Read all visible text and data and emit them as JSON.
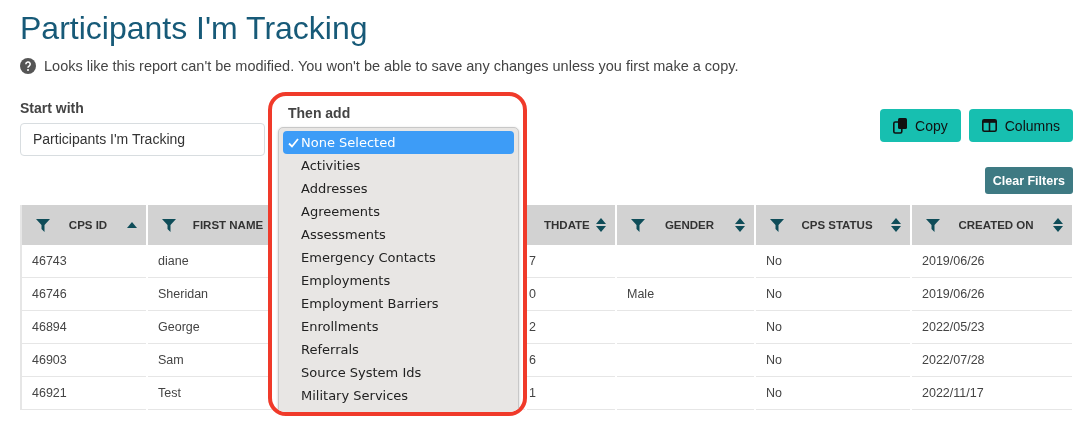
{
  "page": {
    "title": "Participants I'm Tracking",
    "notice": "Looks like this report can't be modified. You won't be able to save any changes unless you first make a copy."
  },
  "start_with": {
    "label": "Start with",
    "value": "Participants I'm Tracking"
  },
  "then_add": {
    "label": "Then add",
    "options": [
      {
        "label": "None Selected",
        "selected": true
      },
      {
        "label": "Activities",
        "selected": false
      },
      {
        "label": "Addresses",
        "selected": false
      },
      {
        "label": "Agreements",
        "selected": false
      },
      {
        "label": "Assessments",
        "selected": false
      },
      {
        "label": "Emergency Contacts",
        "selected": false
      },
      {
        "label": "Employments",
        "selected": false
      },
      {
        "label": "Employment Barriers",
        "selected": false
      },
      {
        "label": "Enrollments",
        "selected": false
      },
      {
        "label": "Referrals",
        "selected": false
      },
      {
        "label": "Source System Ids",
        "selected": false
      },
      {
        "label": "Military Services",
        "selected": false
      }
    ]
  },
  "buttons": [
    {
      "label": "Copy",
      "kind": "copy"
    },
    {
      "label": "Columns",
      "kind": "columns"
    }
  ],
  "clear_filters": "Clear Filters",
  "table": {
    "columns": [
      {
        "label": "CPS ID",
        "filter": true,
        "sorted": true
      },
      {
        "label": "FIRST NAME",
        "filter": true
      },
      {
        "label": "THDATE",
        "filter": false,
        "sorted": false
      },
      {
        "label": "GENDER",
        "filter": true,
        "sorted": false
      },
      {
        "label": "CPS STATUS",
        "filter": true,
        "sorted": false
      },
      {
        "label": "CREATED ON",
        "filter": true,
        "sorted": false
      }
    ],
    "rows": [
      [
        "46743",
        "diane",
        "7",
        null,
        "No",
        "2019/06/26"
      ],
      [
        "46746",
        "Sheridan",
        "0",
        "Male",
        "No",
        "2019/06/26"
      ],
      [
        "46894",
        "George",
        "2",
        null,
        "No",
        "2022/05/23"
      ],
      [
        "46903",
        "Sam",
        "6",
        null,
        "No",
        "2022/07/28"
      ],
      [
        "46921",
        "Test",
        "1",
        null,
        "No",
        "2022/11/17"
      ]
    ]
  }
}
